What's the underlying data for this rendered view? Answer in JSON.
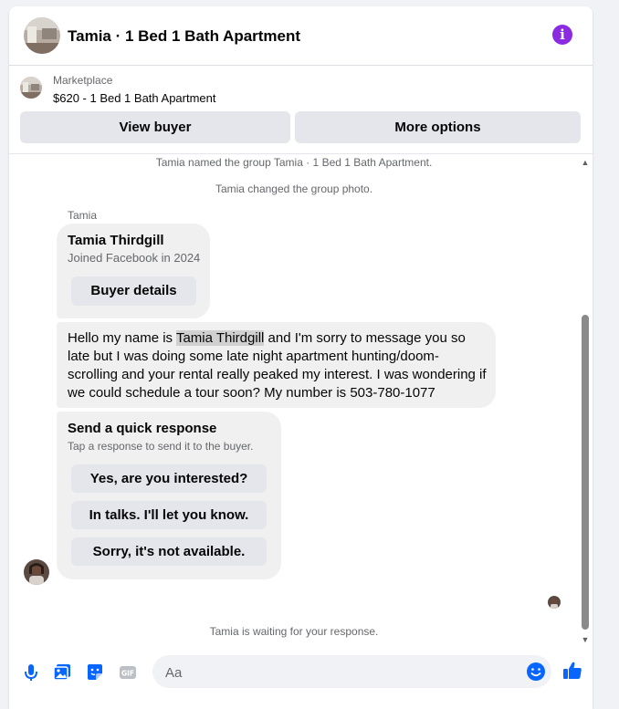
{
  "header": {
    "title": "Tamia · 1 Bed 1 Bath Apartment",
    "info_icon": "i"
  },
  "marketplace": {
    "label": "Marketplace",
    "listing": "$620 - 1 Bed 1 Bath Apartment",
    "view_buyer": "View buyer",
    "more_options": "More options"
  },
  "messages": {
    "sys_named": "Tamia named the group Tamia · 1 Bed 1 Bath Apartment.",
    "sys_photo": "Tamia changed the group photo.",
    "sender": "Tamia",
    "profile_card": {
      "name": "Tamia Thirdgill",
      "joined": "Joined Facebook in 2024",
      "button": "Buyer details"
    },
    "message": {
      "before": "Hello my name is ",
      "highlight": "Tamia Thirdgill",
      "after": " and I'm sorry to message you so late but I was doing some late night apartment hunting/doom-scrolling and your rental really peaked my interest. I was wondering if we could schedule a tour soon? My number is 503-780-1077"
    },
    "quick_response": {
      "title": "Send a quick response",
      "subtitle": "Tap a response to send it to the buyer.",
      "options": [
        "Yes, are you interested?",
        "In talks. I'll let you know.",
        "Sorry, it's not available."
      ]
    },
    "waiting": "Tamia is waiting for your response."
  },
  "composer": {
    "placeholder": "Aa"
  },
  "colors": {
    "accent": "#0866ff",
    "info": "#8a2be2",
    "bubble": "#f0f0f0",
    "button": "#e4e6eb"
  },
  "icons": [
    "mic-icon",
    "photo-icon",
    "sticker-icon",
    "gif-icon",
    "emoji-icon",
    "thumbs-up-icon",
    "info-icon"
  ]
}
